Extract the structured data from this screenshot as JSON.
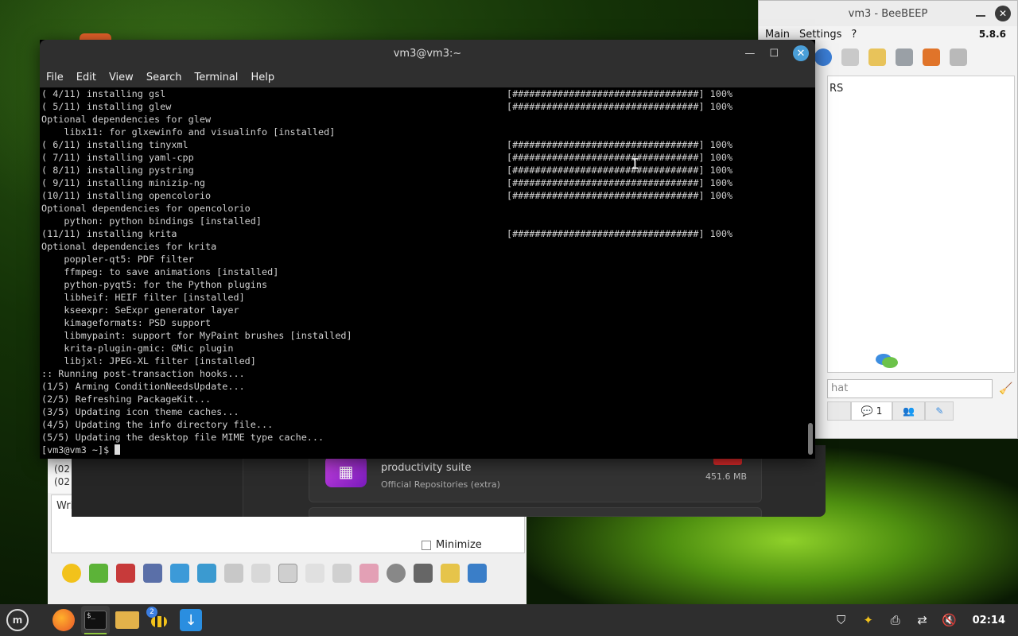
{
  "beebeep": {
    "title": "vm3 - BeeBEEP",
    "menu": [
      "Main",
      "Settings",
      "?"
    ],
    "version": "5.8.6",
    "panel_text": "RS",
    "chat_placeholder": "hat",
    "tab_count": "1"
  },
  "background_app": {
    "left_pane_lines": [
      "(02",
      "(02"
    ],
    "write_label": "Wri",
    "minimize_label": "Minimize"
  },
  "software": {
    "app_name": "productivity suite",
    "app_repo": "Official Repositories (extra)",
    "app_size": "451.6 MB"
  },
  "terminal": {
    "title": "vm3@vm3:~",
    "menu": [
      "File",
      "Edit",
      "View",
      "Search",
      "Terminal",
      "Help"
    ],
    "progress_bar": "[#################################] 100%",
    "lines": [
      {
        "text": "( 4/11) installing gsl",
        "bar": true
      },
      {
        "text": "( 5/11) installing glew",
        "bar": true
      },
      {
        "text": "Optional dependencies for glew",
        "bar": false
      },
      {
        "text": "    libx11: for glxewinfo and visualinfo [installed]",
        "bar": false
      },
      {
        "text": "( 6/11) installing tinyxml",
        "bar": true
      },
      {
        "text": "( 7/11) installing yaml-cpp",
        "bar": true
      },
      {
        "text": "( 8/11) installing pystring",
        "bar": true
      },
      {
        "text": "( 9/11) installing minizip-ng",
        "bar": true
      },
      {
        "text": "(10/11) installing opencolorio",
        "bar": true
      },
      {
        "text": "Optional dependencies for opencolorio",
        "bar": false
      },
      {
        "text": "    python: python bindings [installed]",
        "bar": false
      },
      {
        "text": "(11/11) installing krita",
        "bar": true
      },
      {
        "text": "Optional dependencies for krita",
        "bar": false
      },
      {
        "text": "    poppler-qt5: PDF filter",
        "bar": false
      },
      {
        "text": "    ffmpeg: to save animations [installed]",
        "bar": false
      },
      {
        "text": "    python-pyqt5: for the Python plugins",
        "bar": false
      },
      {
        "text": "    libheif: HEIF filter [installed]",
        "bar": false
      },
      {
        "text": "    kseexpr: SeExpr generator layer",
        "bar": false
      },
      {
        "text": "    kimageformats: PSD support",
        "bar": false
      },
      {
        "text": "    libmypaint: support for MyPaint brushes [installed]",
        "bar": false
      },
      {
        "text": "    krita-plugin-gmic: GMic plugin",
        "bar": false
      },
      {
        "text": "    libjxl: JPEG-XL filter [installed]",
        "bar": false
      },
      {
        "text": ":: Running post-transaction hooks...",
        "bar": false
      },
      {
        "text": "(1/5) Arming ConditionNeedsUpdate...",
        "bar": false
      },
      {
        "text": "(2/5) Refreshing PackageKit...",
        "bar": false
      },
      {
        "text": "(3/5) Updating icon theme caches...",
        "bar": false
      },
      {
        "text": "(4/5) Updating the info directory file...",
        "bar": false
      },
      {
        "text": "(5/5) Updating the desktop file MIME type cache...",
        "bar": false
      }
    ],
    "prompt": "[vm3@vm3 ~]$ "
  },
  "taskbar": {
    "items": [
      "menu-icon",
      "firefox-icon",
      "terminal-icon",
      "files-icon",
      "beebeep-icon",
      "update-manager-icon"
    ],
    "beebeep_badge": "2",
    "terminal_glyph": "$_",
    "clock": "02:14"
  }
}
